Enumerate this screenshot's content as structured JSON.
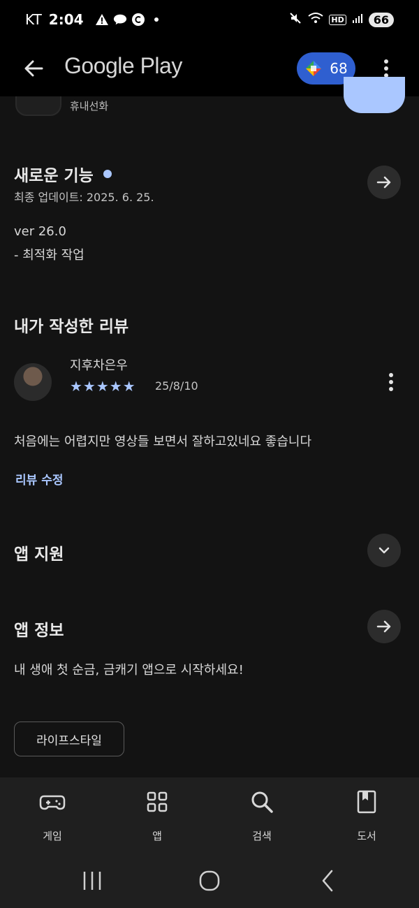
{
  "status_bar": {
    "carrier": "KT",
    "time": "2:04",
    "battery": "66",
    "hd": "HD"
  },
  "app_bar": {
    "title": "Google Play",
    "points": "68"
  },
  "top_strip": {
    "category": "휴내선화"
  },
  "whats_new": {
    "title": "새로운 기능",
    "updated": "최종 업데이트: 2025. 6. 25.",
    "version": "ver 26.0",
    "note": "- 최적화 작업"
  },
  "my_review": {
    "title": "내가 작성한 리뷰",
    "author": "지후차은우",
    "stars": "★★★★★",
    "rating": 5,
    "date": "25/8/10",
    "text": "처음에는 어렵지만 영상들 보면서 잘하고있네요 좋습니다",
    "edit_label": "리뷰 수정"
  },
  "app_support": {
    "title": "앱 지원"
  },
  "app_info": {
    "title": "앱 정보",
    "description": "내 생애 첫 순금, 금캐기 앱으로 시작하세요!",
    "chip": "라이프스타일"
  },
  "bottom_nav": [
    {
      "label": "게임",
      "icon": "gamepad-icon"
    },
    {
      "label": "앱",
      "icon": "apps-grid-icon"
    },
    {
      "label": "검색",
      "icon": "search-icon"
    },
    {
      "label": "도서",
      "icon": "book-icon"
    }
  ],
  "colors": {
    "accent": "#aac7ff",
    "points_badge": "#2f5fd0",
    "background": "#131313"
  }
}
